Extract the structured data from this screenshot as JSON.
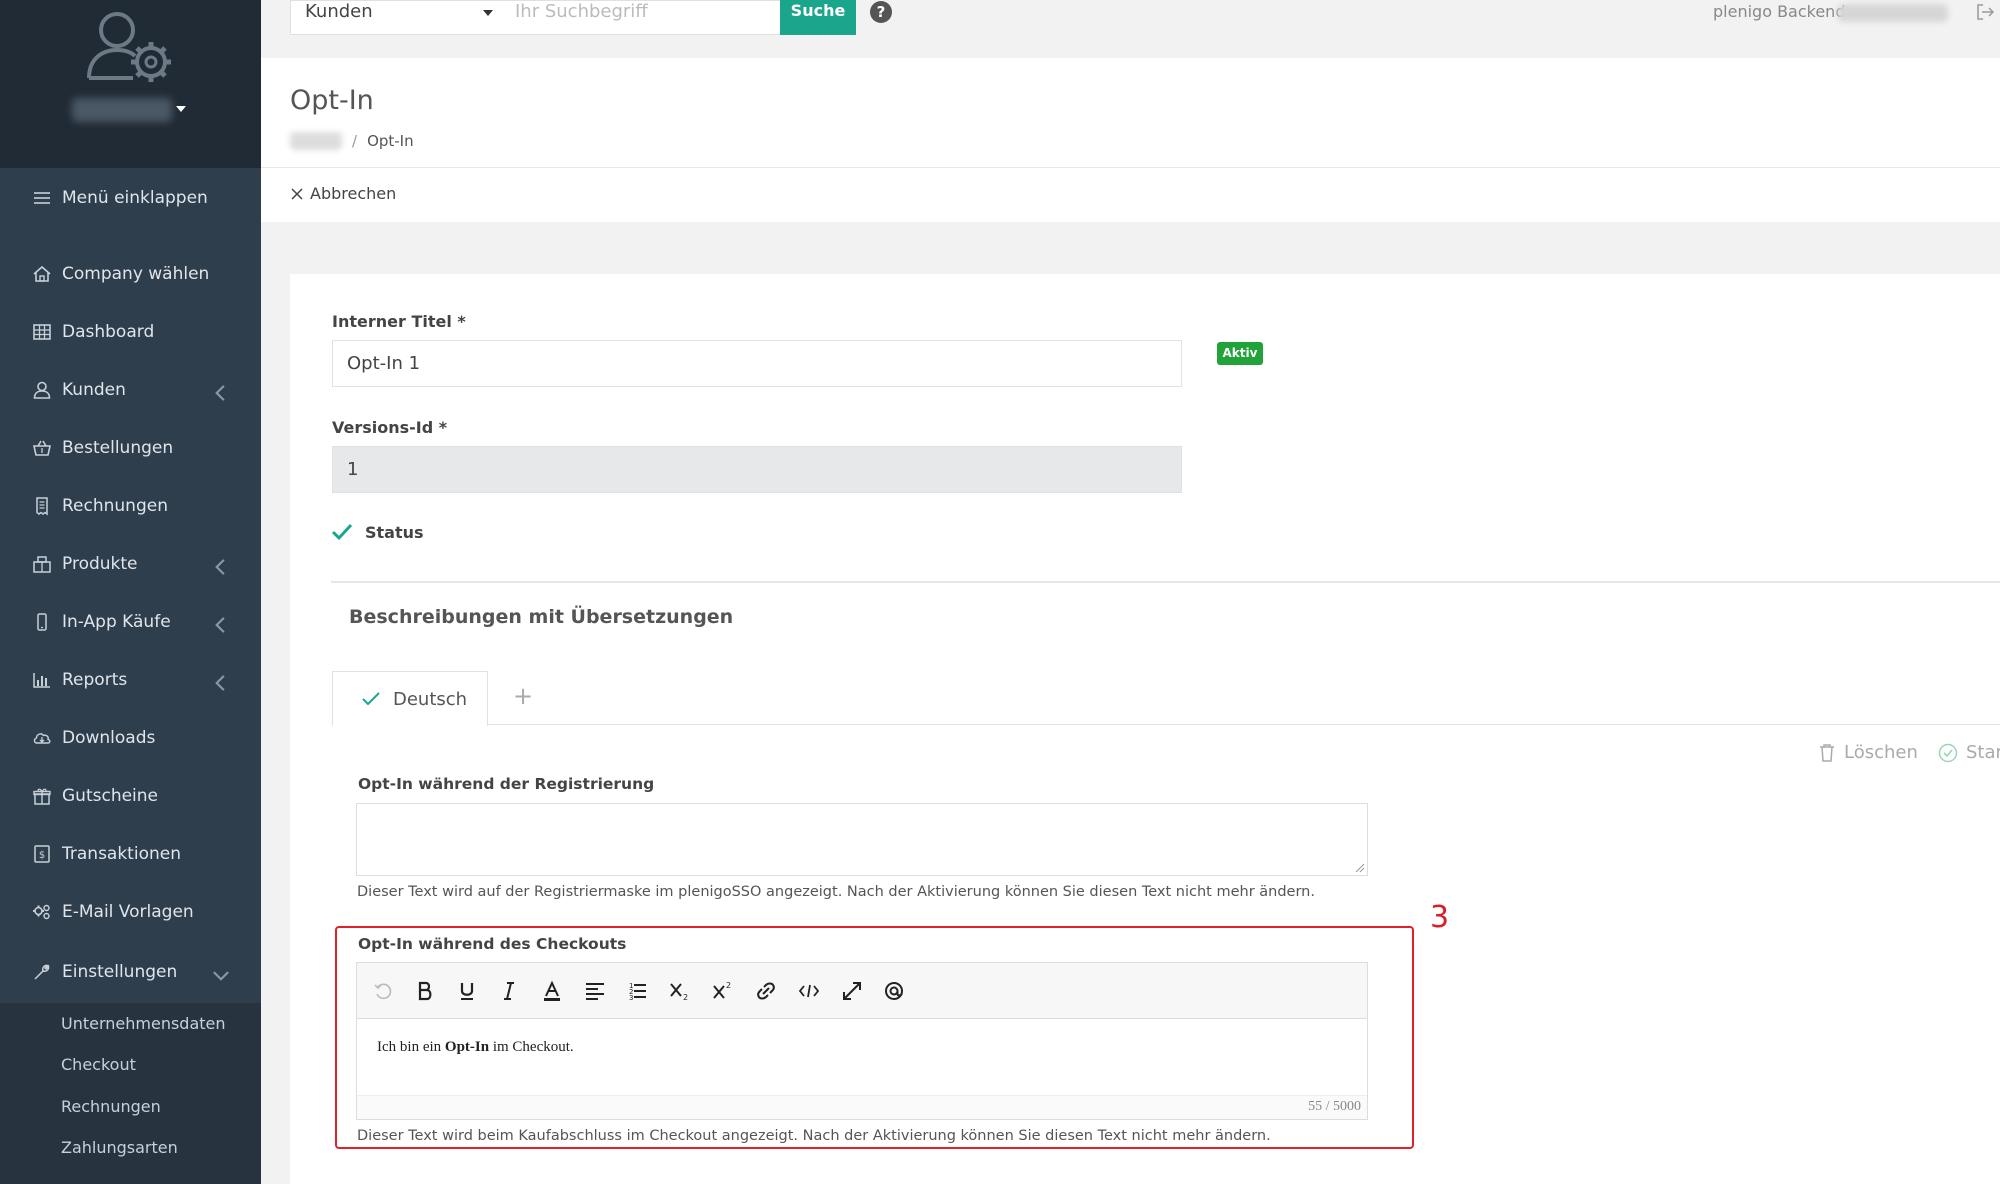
{
  "sidebar": {
    "collapse_label": "Menü einklappen",
    "items": [
      {
        "label": "Company wählen",
        "icon": "home-icon"
      },
      {
        "label": "Dashboard",
        "icon": "grid-icon"
      },
      {
        "label": "Kunden",
        "icon": "user-icon"
      },
      {
        "label": "Bestellungen",
        "icon": "basket-icon"
      },
      {
        "label": "Rechnungen",
        "icon": "receipt-icon"
      },
      {
        "label": "Produkte",
        "icon": "products-icon"
      },
      {
        "label": "In-App Käufe",
        "icon": "mobile-icon"
      },
      {
        "label": "Reports",
        "icon": "bar-chart-icon"
      },
      {
        "label": "Downloads",
        "icon": "cloud-download-icon"
      },
      {
        "label": "Gutscheine",
        "icon": "gift-icon"
      },
      {
        "label": "Transaktionen",
        "icon": "money-icon"
      },
      {
        "label": "E-Mail Vorlagen",
        "icon": "gears-icon"
      },
      {
        "label": "Einstellungen",
        "icon": "wrench-icon"
      }
    ],
    "subitems": [
      "Unternehmensdaten",
      "Checkout",
      "Rechnungen",
      "Zahlungsarten"
    ]
  },
  "topbar": {
    "select_value": "Kunden",
    "search_placeholder": "Ihr Suchbegriff",
    "search_button": "Suche",
    "backend_label": "plenigo Backend"
  },
  "header": {
    "title": "Opt-In",
    "breadcrumb_current": "Opt-In",
    "cancel_label": "Abbrechen"
  },
  "form": {
    "internal_title_label": "Interner Titel *",
    "internal_title_value": "Opt-In 1",
    "active_badge": "Aktiv",
    "version_label": "Versions-Id *",
    "version_value": "1",
    "status_label": "Status",
    "section_title": "Beschreibungen mit Übersetzungen",
    "tab_label": "Deutsch",
    "tab_add": "+",
    "delete_label": "Löschen",
    "star_label": "Star",
    "registration_label": "Opt-In während der Registrierung",
    "registration_help": "Dieser Text wird auf der Registriermaske im plenigoSSO angezeigt. Nach der Aktivierung können Sie diesen Text nicht mehr ändern.",
    "checkout_label": "Opt-In während des Checkouts",
    "checkout_text_before": "Ich bin ein ",
    "checkout_text_bold": "Opt-In",
    "checkout_text_after": " im Checkout.",
    "char_count": "55 / 5000",
    "checkout_help": "Dieser Text wird beim Kaufabschluss im Checkout angezeigt. Nach der Aktivierung können Sie diesen Text nicht mehr ändern.",
    "annotation_number": "3"
  },
  "colors": {
    "sidebar_bg": "#2f3e4d",
    "accent": "#1aa68c",
    "active_badge": "#21a33a",
    "highlight": "#e0202a"
  }
}
